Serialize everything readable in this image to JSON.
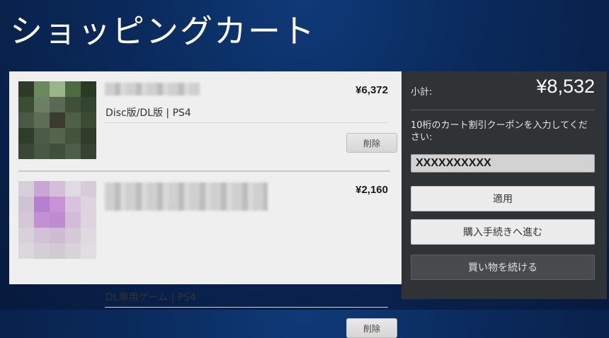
{
  "page": {
    "title": "ショッピングカート"
  },
  "cart": {
    "items": [
      {
        "name": "■■■■■■■■■",
        "price": "¥6,372",
        "description": "Disc版/DL版 | PS4",
        "delete_label": "削除"
      },
      {
        "name": "■■■■■■■■■■■■■■",
        "price": "¥2,160",
        "description": "DL専用ゲーム | PS4",
        "delete_label": "削除"
      }
    ]
  },
  "summary": {
    "subtotal_label": "小計:",
    "subtotal_value": "¥8,532",
    "coupon_label": "10桁のカート割引クーポンを入力してください:",
    "coupon_value": "XXXXXXXXXX",
    "apply_label": "適用",
    "checkout_label": "購入手続きへ進む",
    "continue_label": "買い物を続ける"
  },
  "colors": {
    "background": "#0a2a5c",
    "summary_panel": "#2f3336",
    "cart_panel": "#efefef"
  },
  "icons": {
    "item1_thumbnail": "blurred-product-image",
    "item2_thumbnail": "blurred-product-image"
  }
}
